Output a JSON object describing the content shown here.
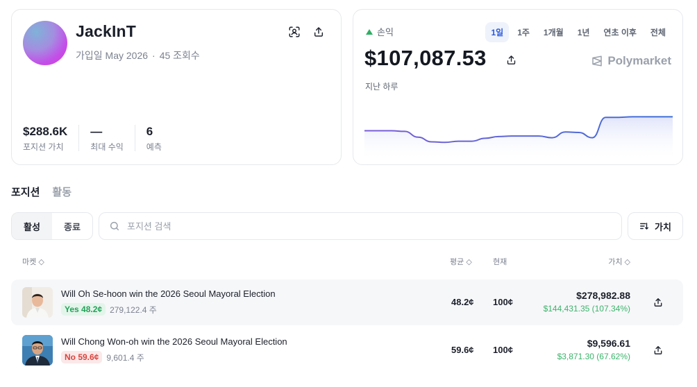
{
  "profile": {
    "username": "JackInT",
    "joined": "가입일 May 2026",
    "views": "45 조회수",
    "stats": [
      {
        "value": "$288.6K",
        "label": "포지션 가치"
      },
      {
        "value": "—",
        "label": "최대 수익"
      },
      {
        "value": "6",
        "label": "예측"
      }
    ]
  },
  "pnl": {
    "label": "손익",
    "value": "$107,087.53",
    "brand": "Polymarket",
    "period": "지난 하루",
    "tabs": [
      "1일",
      "1주",
      "1개월",
      "1년",
      "연초 이후",
      "전체"
    ],
    "active_tab": 0,
    "trend_color": "#2fae63"
  },
  "chart_data": {
    "type": "area",
    "series": [
      {
        "values": [
          47,
          47,
          47,
          46,
          36,
          28,
          27,
          29,
          29,
          34,
          37,
          38,
          38,
          38,
          35,
          45,
          44,
          35,
          70,
          70,
          71,
          71,
          71,
          71
        ]
      }
    ],
    "colors": {
      "line_start": "#7a5cd6",
      "line_end": "#3e6fd8",
      "fill": "#e9ebfb"
    }
  },
  "sections": {
    "tabs": [
      "포지션",
      "활동"
    ],
    "active": 0
  },
  "filters": {
    "segments": [
      "활성",
      "종료"
    ],
    "active": 0,
    "search_placeholder": "포지션 검색",
    "sort_label": "가치"
  },
  "table": {
    "headers": {
      "market": "마켓",
      "avg": "평균",
      "current": "현재",
      "value": "가치"
    },
    "rows": [
      {
        "title": "Will Oh Se-hoon win the 2026 Seoul Mayoral Election",
        "outcome": "Yes 48.2¢",
        "outcome_type": "yes",
        "shares": "279,122.4 주",
        "avg": "48.2¢",
        "current": "100¢",
        "value": "$278,982.88",
        "gain": "$144,431.35 (107.34%)"
      },
      {
        "title": "Will Chong Won-oh win the 2026 Seoul Mayoral Election",
        "outcome": "No 59.6¢",
        "outcome_type": "no",
        "shares": "9,601.4 주",
        "avg": "59.6¢",
        "current": "100¢",
        "value": "$9,596.61",
        "gain": "$3,871.30 (67.62%)"
      }
    ]
  }
}
